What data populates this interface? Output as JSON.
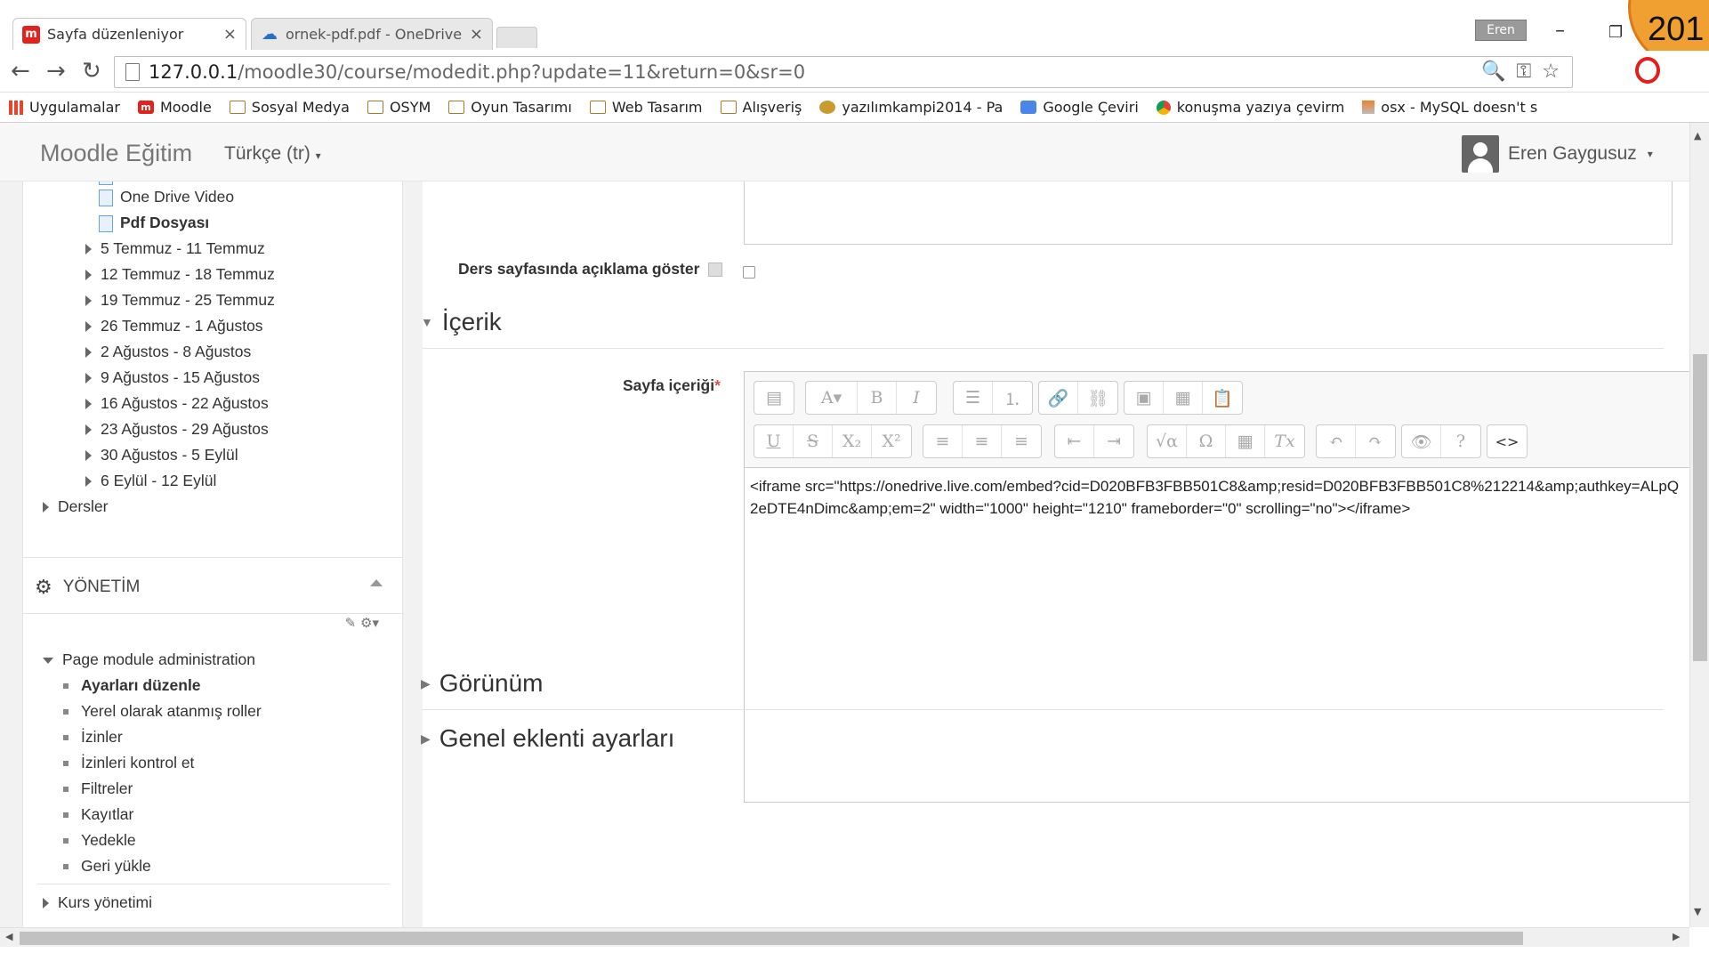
{
  "browser": {
    "tabs": [
      {
        "title": "Sayfa düzenleniyor",
        "active": true
      },
      {
        "title": "ornek-pdf.pdf - OneDrive",
        "active": false
      }
    ],
    "tab_close_glyph": "×",
    "profile_name": "Eren",
    "window_controls": {
      "minimize": "–",
      "restore": "❐"
    },
    "overlay_number": "201",
    "nav": {
      "back": "←",
      "forward": "→",
      "reload": "↻"
    },
    "url": {
      "host": "127.0.0.1",
      "path": "/moodle30/course/modedit.php?update=11&return=0&sr=0"
    },
    "omnibox_icons": {
      "zoom": "🔍",
      "key": "⚿",
      "star": "☆"
    },
    "bookmarks": [
      {
        "label": "Uygulamalar",
        "icon": "apps-grid-icon"
      },
      {
        "label": "Moodle",
        "icon": "moodle-icon"
      },
      {
        "label": "Sosyal Medya",
        "icon": "folder-icon"
      },
      {
        "label": "OSYM",
        "icon": "folder-icon"
      },
      {
        "label": "Oyun Tasarımı",
        "icon": "folder-icon"
      },
      {
        "label": "Web Tasarım",
        "icon": "folder-icon"
      },
      {
        "label": "Alışveriş",
        "icon": "folder-icon"
      },
      {
        "label": "yazılımkampi2014 - Pa",
        "icon": "cat-icon"
      },
      {
        "label": "Google Çeviri",
        "icon": "translate-icon"
      },
      {
        "label": "konuşma yazıya çevirm",
        "icon": "chrome-icon"
      },
      {
        "label": "osx - MySQL doesn't s",
        "icon": "stack-icon"
      }
    ]
  },
  "moodle": {
    "brand": "Moodle Eğitim",
    "language": "Türkçe (tr)",
    "user_name": "Eren Gaygusuz",
    "nav_tree": {
      "activities": [
        "One Drive Video",
        "Pdf Dosyası"
      ],
      "weeks": [
        "5 Temmuz - 11 Temmuz",
        "12 Temmuz - 18 Temmuz",
        "19 Temmuz - 25 Temmuz",
        "26 Temmuz - 1 Ağustos",
        "2 Ağustos - 8 Ağustos",
        "9 Ağustos - 15 Ağustos",
        "16 Ağustos - 22 Ağustos",
        "23 Ağustos - 29 Ağustos",
        "30 Ağustos - 5 Eylül",
        "6 Eylül - 12 Eylül"
      ],
      "courses": "Dersler"
    },
    "admin": {
      "title": "YÖNETİM",
      "small_icons": "✎ ⚙▾",
      "module_admin": "Page module administration",
      "items": [
        "Ayarları düzenle",
        "Yerel olarak atanmış roller",
        "İzinler",
        "İzinleri kontrol et",
        "Filtreler",
        "Kayıtlar",
        "Yedekle",
        "Geri yükle"
      ],
      "course_admin": "Kurs yönetimi"
    },
    "form": {
      "show_description_label": "Ders sayfasında açıklama göster",
      "section_content": "İçerik",
      "page_content_label": "Sayfa içeriği",
      "required_mark": "*",
      "section_appearance": "Görünüm",
      "section_plugins": "Genel eklenti ayarları",
      "editor_html": "<iframe src=\"https://onedrive.live.com/embed?cid=D020BFB3FBB501C8&amp;resid=D020BFB3FBB501C8%212214&amp;authkey=ALpQ2eDTE4nDimc&amp;em=2\" width=\"1000\" height=\"1210\" frameborder=\"0\" scrolling=\"no\"></iframe>"
    },
    "editor_toolbar_row1": [
      [
        "▤"
      ],
      [
        "A▾",
        "B",
        "I"
      ],
      [
        "☰",
        "⒈"
      ],
      [
        "🔗",
        "⛓"
      ],
      [
        "▣",
        "▦",
        "📋"
      ]
    ],
    "editor_toolbar_row2": [
      [
        "U",
        "S",
        "X₂",
        "X²"
      ],
      [
        "≡",
        "≡",
        "≡"
      ],
      [
        "⇤",
        "⇥"
      ],
      [
        "√α",
        "Ω",
        "▦",
        "Tx"
      ],
      [
        "↶",
        "↷"
      ],
      [
        "👁",
        "?"
      ],
      [
        "<>"
      ]
    ]
  },
  "scrollbars": {
    "up": "▲",
    "down": "▼",
    "left": "◀",
    "right": "▶"
  }
}
